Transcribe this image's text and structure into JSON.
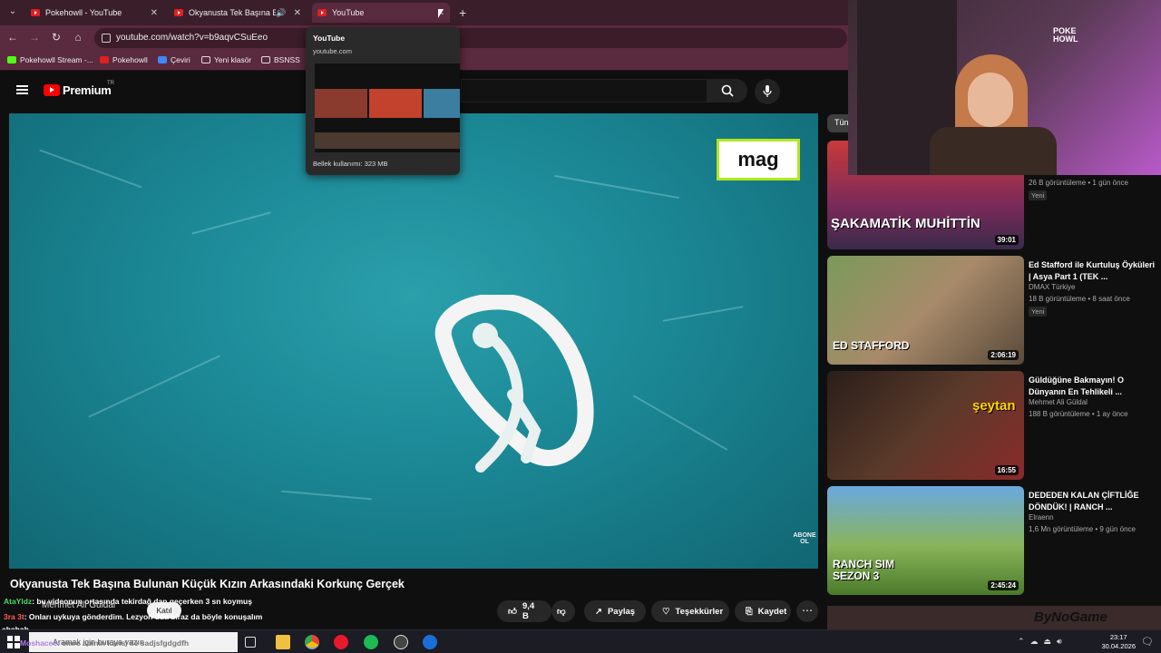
{
  "browser": {
    "tabs": [
      {
        "title": "Pokehowll - YouTube"
      },
      {
        "title": "Okyanusta Tek Başına Bulun"
      },
      {
        "title": "YouTube"
      }
    ],
    "url": "youtube.com/watch?v=b9aqvCSuEeo",
    "bookmarks": [
      "Pokehowll Stream -...",
      "Pokehowll",
      "Çeviri",
      "Yeni klasör",
      "BSNSS"
    ]
  },
  "hovercard": {
    "title": "YouTube",
    "domain": "youtube.com",
    "memory": "Bellek kullanımı: 323 MB"
  },
  "youtube": {
    "logo": "Premium",
    "region": "TR",
    "filter_chip": "Tün"
  },
  "video": {
    "watermark": "mag",
    "subscribe_watermark": "ABONE OL",
    "title": "Okyanusta Tek Başına Bulunan Küçük Kızın Arkasındaki Korkunç Gerçek",
    "channel": "Mehmet Ali Güldal",
    "join": "Katıl",
    "likes": "9,4 B",
    "share": "Paylaş",
    "thanks": "Teşekkürler",
    "save": "Kaydet"
  },
  "chat_overlay": [
    {
      "user": "AtaYldz",
      "text": ": bu videonun ortasında tekirdağ dan geçerken 3 sn koymuş"
    },
    {
      "user": "3ra 3t",
      "text": ": Onları uykuya gönderdim. Lezyon dda biraz da böyle konuşalım"
    },
    {
      "user": "",
      "text": "ahahah"
    },
    {
      "user": "Moshacee",
      "text": ": emre abinin karisi ile sadjsfgdgdfh"
    }
  ],
  "recommendations": [
    {
      "title": "",
      "channel": "",
      "views": "26 B görüntüleme • 1 gün önce",
      "badge": "Yeni",
      "duration": "39:01",
      "thumb_text": "ŞAKAMATİK MUHİTTİN"
    },
    {
      "title": "Ed Stafford ile Kurtuluş Öyküleri | Asya Part 1 (TEK ...",
      "channel": "DMAX Türkiye",
      "views": "18 B görüntüleme • 8 saat önce",
      "badge": "Yeni",
      "duration": "2:06:19",
      "thumb_text": "ED STAFFORD"
    },
    {
      "title": "Güldüğüne Bakmayın! O Dünyanın En Tehlikeli ...",
      "channel": "Mehmet Ali Güldal",
      "views": "188 B görüntüleme • 1 ay önce",
      "badge": "",
      "duration": "16:55",
      "thumb_text": "şeytan"
    },
    {
      "title": "DEDEDEN KALAN ÇİFTLİĞE DÖNDÜK! | RANCH ...",
      "channel": "Elraenn",
      "views": "1,6 Mn görüntüleme • 9 gün önce",
      "badge": "",
      "duration": "2:45:24",
      "thumb_text": "RANCH SIM SEZON 3"
    }
  ],
  "stream_overlay": {
    "brand": "ByNoGame"
  },
  "taskbar": {
    "search_placeholder": "Aramak için buraya yazın",
    "time": "23:17",
    "date": "30.04.2026"
  }
}
